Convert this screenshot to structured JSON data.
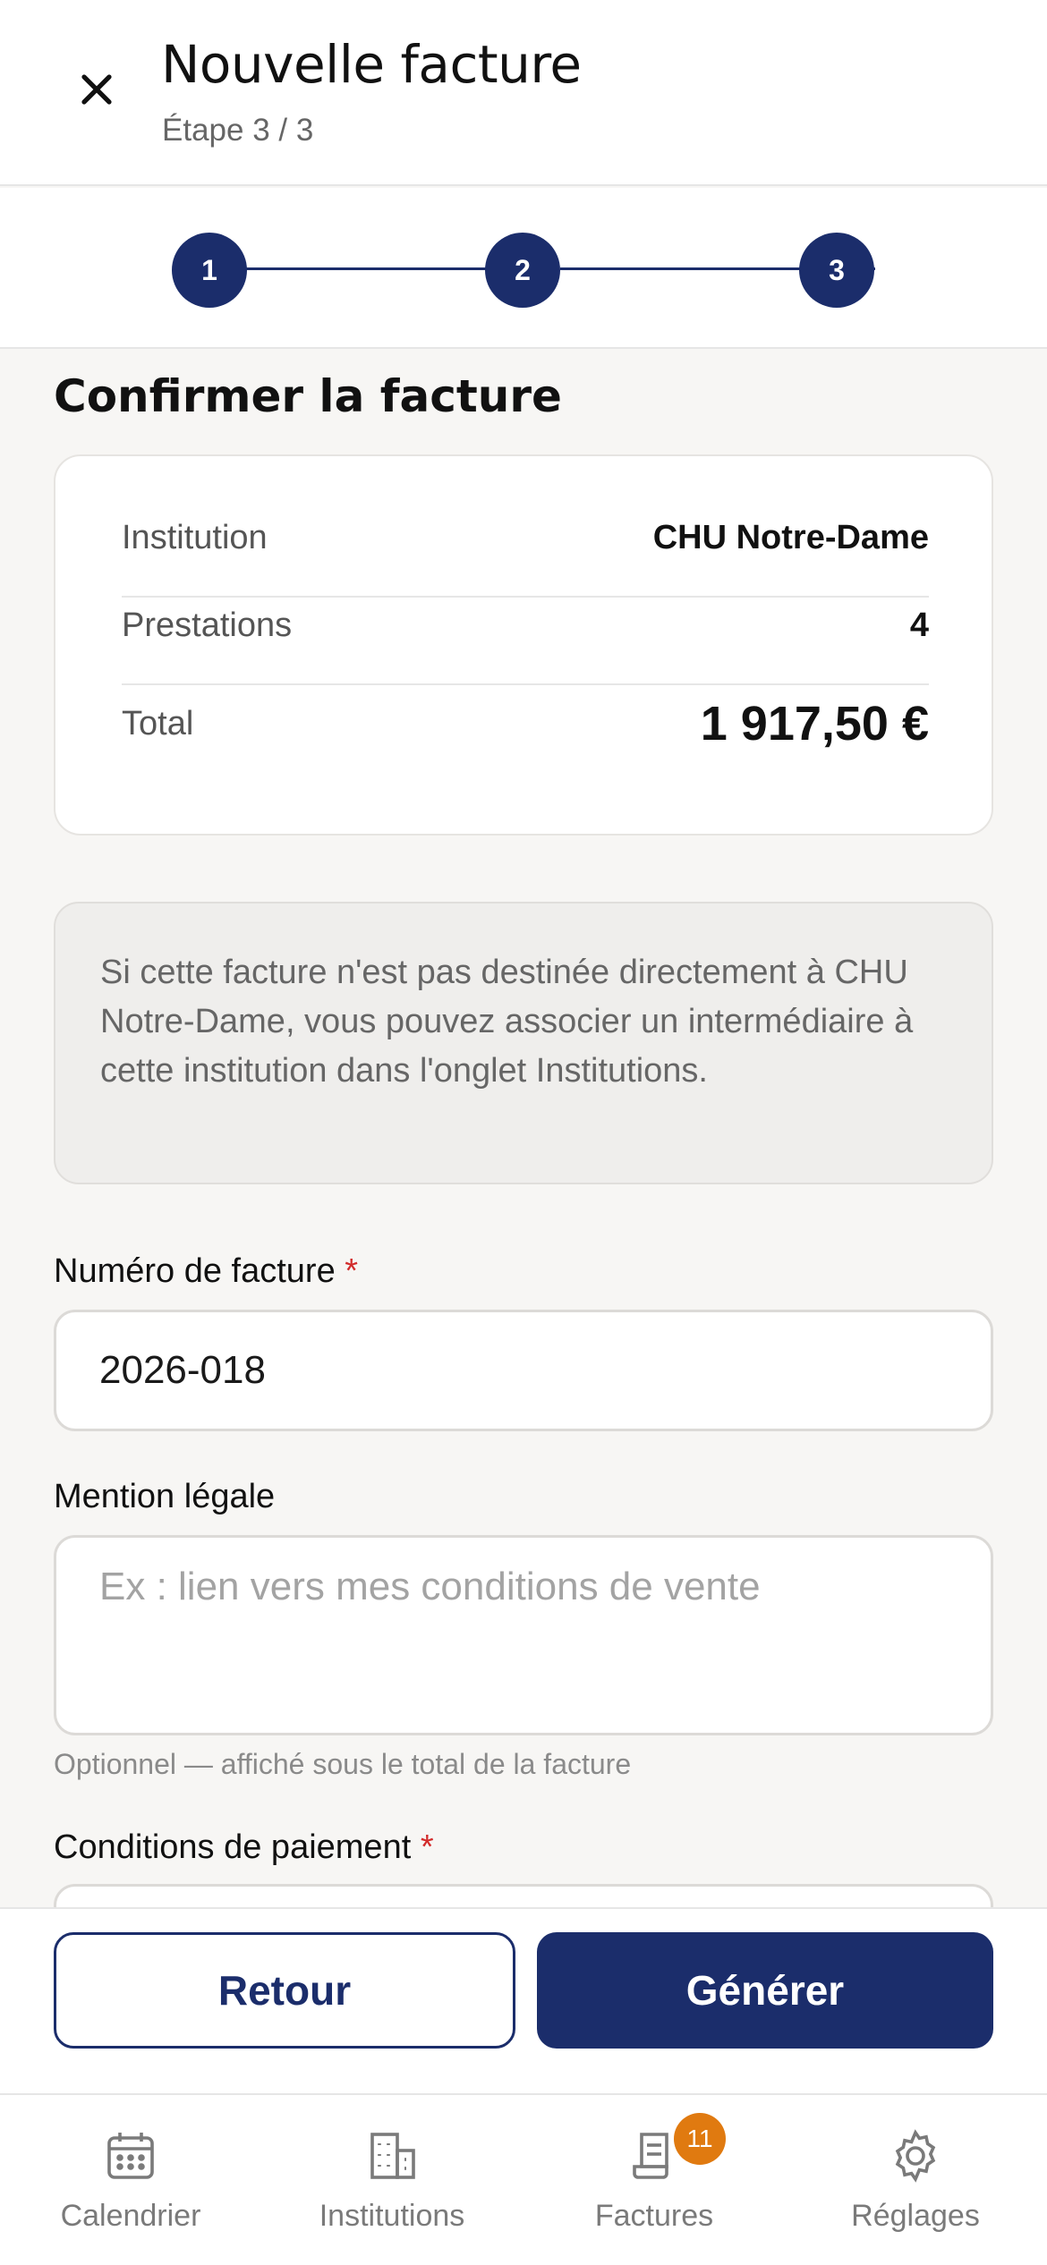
{
  "header": {
    "title": "Nouvelle facture",
    "subtitle": "Étape 3 / 3"
  },
  "stepper": {
    "steps": [
      "1",
      "2",
      "3"
    ],
    "active_color": "#1b2d6b"
  },
  "section": {
    "title": "Confirmer la facture"
  },
  "summary": {
    "institution_label": "Institution",
    "institution_value": "CHU Notre-Dame",
    "prestations_label": "Prestations",
    "prestations_value": "4",
    "total_label": "Total",
    "total_value": "1 917,50 €"
  },
  "info": {
    "text": "Si cette facture n'est pas destinée directement à CHU Notre-Dame, vous pouvez associer un intermédiaire à cette institution dans l'onglet Institutions."
  },
  "form": {
    "invoice_number_label": "Numéro de facture",
    "invoice_number_value": "2026-018",
    "required_marker": "*",
    "legal_label": "Mention légale",
    "legal_placeholder": "Ex : lien vers mes conditions de vente",
    "legal_hint": "Optionnel — affiché sous le total de la facture",
    "payment_label": "Conditions de paiement"
  },
  "actions": {
    "back_label": "Retour",
    "generate_label": "Générer"
  },
  "tabbar": {
    "items": [
      {
        "label": "Calendrier",
        "icon": "calendar-icon"
      },
      {
        "label": "Institutions",
        "icon": "building-icon"
      },
      {
        "label": "Factures",
        "icon": "invoice-icon",
        "badge": "11"
      },
      {
        "label": "Réglages",
        "icon": "gear-icon"
      }
    ],
    "badge_color": "#e07a10"
  },
  "colors": {
    "primary": "#1b2d6b",
    "required": "#d22b2b"
  }
}
